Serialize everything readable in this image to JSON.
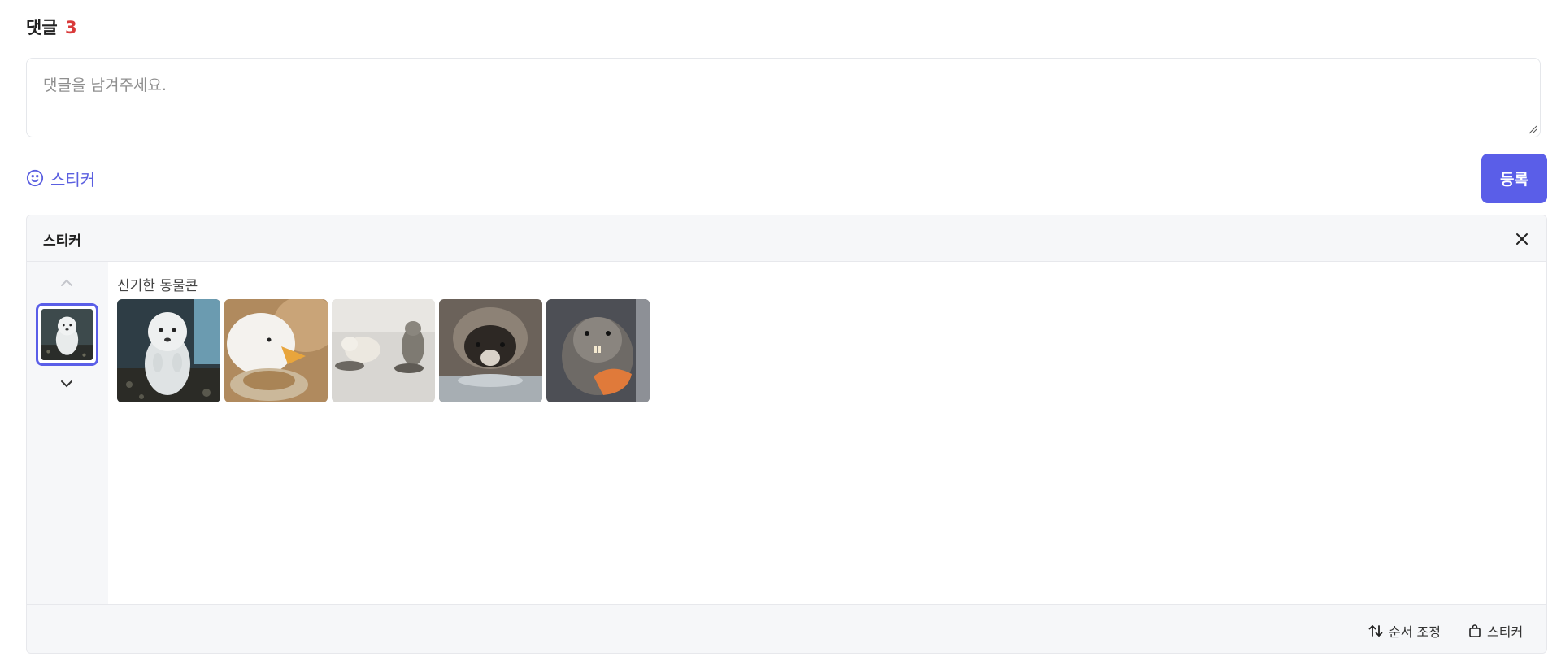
{
  "comments": {
    "label": "댓글",
    "count": "3",
    "placeholder": "댓글을 남겨주세요.",
    "sticker_toggle_label": "스티커",
    "submit_label": "등록"
  },
  "sticker_panel": {
    "title": "스티커",
    "pack_title": "신기한 동물콘",
    "stickers": [
      {
        "subject": "white seal"
      },
      {
        "subject": "duck"
      },
      {
        "subject": "puppy and cat"
      },
      {
        "subject": "raccoon"
      },
      {
        "subject": "beaver"
      }
    ],
    "footer": {
      "reorder_label": "순서 조정",
      "store_label": "스티커"
    }
  },
  "colors": {
    "accent": "#5a5ee8",
    "count": "#d93a3a"
  },
  "icons": [
    "smile-icon",
    "close-icon",
    "chevron-up-icon",
    "chevron-down-icon",
    "sort-arrows-icon",
    "shopping-bag-icon",
    "resize-grip-icon"
  ]
}
